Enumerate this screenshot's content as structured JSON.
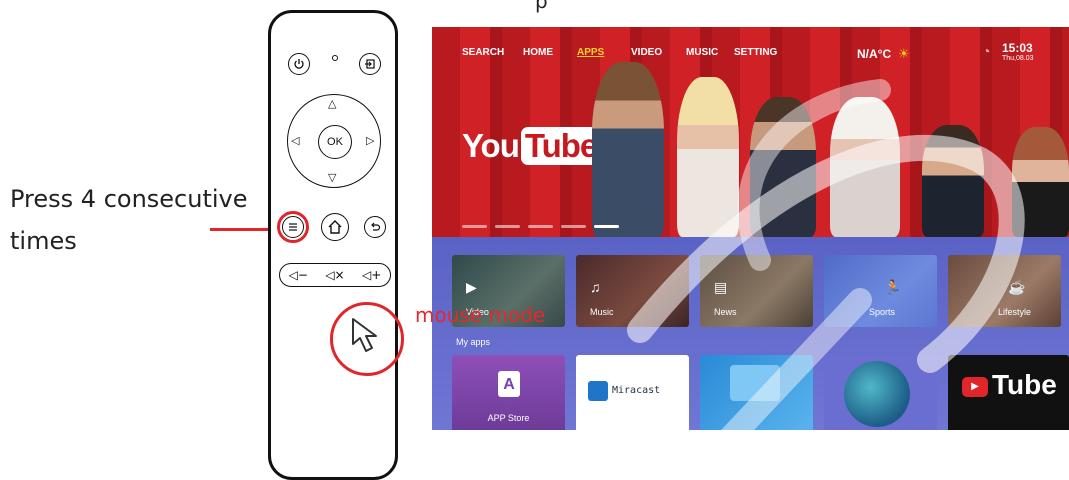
{
  "caption_top": "p",
  "instruction": {
    "line1": "Press 4 consecutive",
    "line2": "times"
  },
  "remote": {
    "ok_label": "OK",
    "arrows": {
      "up": "△",
      "down": "▽",
      "left": "◁",
      "right": "▷"
    },
    "vol_down": "◁−",
    "mute": "◁×",
    "vol_up": "◁+"
  },
  "screen": {
    "nav": [
      "SEARCH",
      "HOME",
      "APPS",
      "VIDEO",
      "MUSIC",
      "SETTING"
    ],
    "active_nav": "APPS",
    "temperature": "N/A°C",
    "time": "15:03",
    "date": "Thu,08.03",
    "banner_you": "You",
    "banner_tube": "Tube",
    "categories": [
      "Video",
      "Music",
      "News",
      "Sports",
      "Lifestyle"
    ],
    "my_apps_label": "My apps",
    "apps": {
      "app_store": "APP Store",
      "miracast": "Miracast",
      "youtube_tube": "Tube"
    },
    "mouse_mode_label": "mouse mode"
  },
  "colors": {
    "accent_red": "#e0262b",
    "nav_active": "#ffcf2a",
    "hero_red": "#c51b20",
    "panel_blue": "#6a6ed0"
  }
}
